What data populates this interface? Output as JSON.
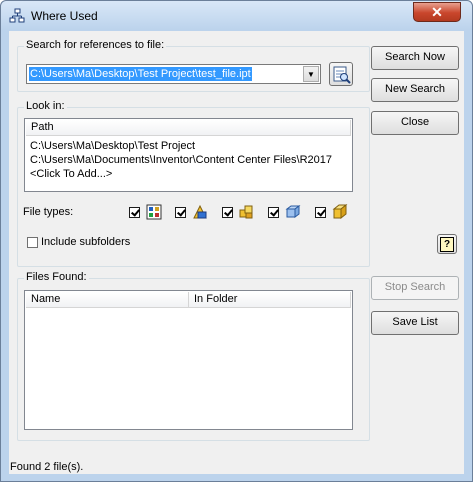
{
  "window": {
    "title": "Where Used",
    "close_label": "✕"
  },
  "search": {
    "group_label": "Search for references to file:",
    "file_value": "C:\\Users\\Ma\\Desktop\\Test Project\\test_file.ipt"
  },
  "buttons": {
    "search_now": "Search Now",
    "new_search": "New Search",
    "close": "Close",
    "help": "?",
    "stop_search": "Stop Search",
    "save_list": "Save List"
  },
  "look_in": {
    "group_label": "Look in:",
    "column_header": "Path",
    "paths": [
      "C:\\Users\\Ma\\Desktop\\Test Project",
      "C:\\Users\\Ma\\Documents\\Inventor\\Content Center Files\\R2017",
      "<Click To Add...>"
    ]
  },
  "file_types": {
    "label": "File types:",
    "items": [
      {
        "icon": "drawing-icon",
        "checked": true
      },
      {
        "icon": "presentation-icon",
        "checked": true
      },
      {
        "icon": "assembly-icon",
        "checked": true
      },
      {
        "icon": "sheet-metal-icon",
        "checked": true
      },
      {
        "icon": "part-icon",
        "checked": true
      }
    ]
  },
  "subfolders": {
    "label": "Include subfolders",
    "checked": false
  },
  "files_found": {
    "group_label": "Files Found:",
    "columns": [
      "Name",
      "In Folder"
    ]
  },
  "status": {
    "text": "Found 2 file(s)."
  },
  "colors": {
    "selection": "#3399ff",
    "close_button": "#c9462c",
    "titlebar": "#bcd3ec"
  }
}
